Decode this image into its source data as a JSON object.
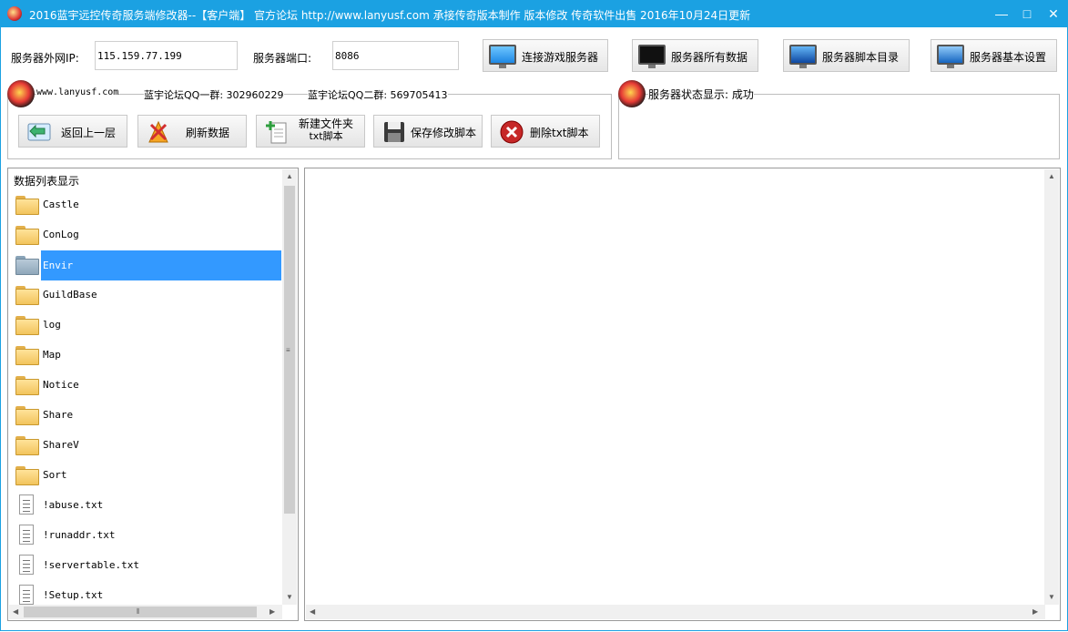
{
  "window": {
    "title": "2016蓝宇远控传奇服务端修改器--【客户端】  官方论坛 http://www.lanyusf.com  承接传奇版本制作 版本修改 传奇软件出售 2016年10月24日更新",
    "minimize_glyph": "—",
    "maximize_glyph": "□",
    "close_glyph": "✕"
  },
  "connection": {
    "ip_label": "服务器外网IP:",
    "ip_value": "115.159.77.199",
    "port_label": "服务器端口:",
    "port_value": "8086"
  },
  "toolbar": {
    "connect_label": "连接游戏服务器",
    "all_data_label": "服务器所有数据",
    "script_dir_label": "服务器脚本目录",
    "basic_settings_label": "服务器基本设置"
  },
  "info_group": {
    "site": "www.lanyusf.com",
    "qq1": "蓝宇论坛QQ一群: 302960229",
    "qq2": "蓝宇论坛QQ二群: 569705413"
  },
  "actions": {
    "back_label": "返回上一层",
    "refresh_label": "刷新数据",
    "new_folder_line1": "新建文件夹",
    "new_folder_line2": "txt脚本",
    "save_label": "保存修改脚本",
    "delete_label": "删除txt脚本"
  },
  "status": {
    "text": "服务器状态显示: 成功"
  },
  "file_list": {
    "header": "数据列表显示",
    "items": [
      {
        "name": "Castle",
        "type": "folder"
      },
      {
        "name": "ConLog",
        "type": "folder"
      },
      {
        "name": "Envir",
        "type": "folder",
        "selected": true
      },
      {
        "name": "GuildBase",
        "type": "folder"
      },
      {
        "name": "log",
        "type": "folder"
      },
      {
        "name": "Map",
        "type": "folder"
      },
      {
        "name": "Notice",
        "type": "folder"
      },
      {
        "name": "Share",
        "type": "folder"
      },
      {
        "name": "ShareV",
        "type": "folder"
      },
      {
        "name": "Sort",
        "type": "folder"
      },
      {
        "name": "!abuse.txt",
        "type": "file"
      },
      {
        "name": "!runaddr.txt",
        "type": "file"
      },
      {
        "name": "!servertable.txt",
        "type": "file"
      },
      {
        "name": "!Setup.txt",
        "type": "file"
      }
    ]
  },
  "colors": {
    "titlebar": "#1ba1e2",
    "selection": "#3399ff"
  }
}
